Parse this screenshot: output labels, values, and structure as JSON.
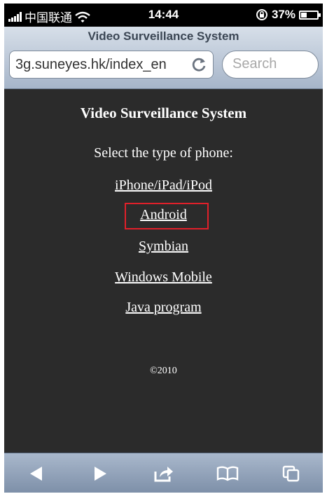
{
  "status_bar": {
    "carrier": "中国联通",
    "time": "14:44",
    "battery": "37%",
    "battery_level": 0.37
  },
  "browser": {
    "page_title": "Video Surveillance System",
    "url": "3g.suneyes.hk/index_en",
    "search_placeholder": "Search"
  },
  "content": {
    "heading": "Video Surveillance System",
    "subheading": "Select the type of phone:",
    "links": [
      "iPhone/iPad/iPod",
      "Android",
      "Symbian",
      "Windows Mobile",
      "Java program"
    ],
    "highlighted_link": "Android",
    "highlight_color": "#e0202a",
    "copyright": "©2010"
  },
  "toolbar": {
    "icons": [
      "back-icon",
      "forward-icon",
      "share-icon",
      "bookmarks-icon",
      "pages-icon"
    ]
  }
}
